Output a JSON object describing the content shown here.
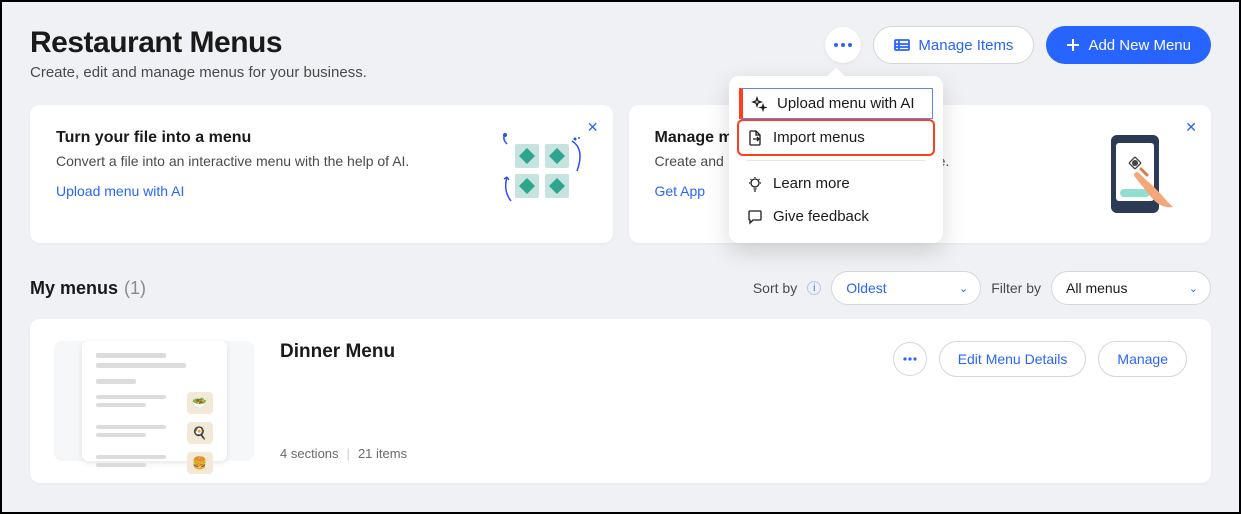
{
  "header": {
    "title": "Restaurant Menus",
    "subtitle": "Create, edit and manage menus for your business.",
    "manage_items": "Manage Items",
    "add_new_menu": "Add New Menu"
  },
  "dropdown": {
    "upload_ai": "Upload menu with AI",
    "import": "Import menus",
    "learn_more": "Learn more",
    "feedback": "Give feedback"
  },
  "cards": {
    "turn_file": {
      "title": "Turn your file into a menu",
      "body": "Convert a file into an interactive menu with the help of AI.",
      "link": "Upload menu with AI"
    },
    "manage_app": {
      "title_prefix": "Manage m",
      "body_prefix": "Create and ",
      "body_suffix": "e.",
      "link": "Get App"
    }
  },
  "my_menus": {
    "label": "My menus",
    "count": "(1)",
    "sort_label": "Sort by",
    "sort_value": "Oldest",
    "filter_label": "Filter by",
    "filter_value": "All menus"
  },
  "menu_item": {
    "title": "Dinner Menu",
    "sections": "4 sections",
    "items": "21 items",
    "edit": "Edit Menu Details",
    "manage": "Manage"
  },
  "colors": {
    "primary": "#2864ff",
    "highlight": "#ff3e1d"
  }
}
